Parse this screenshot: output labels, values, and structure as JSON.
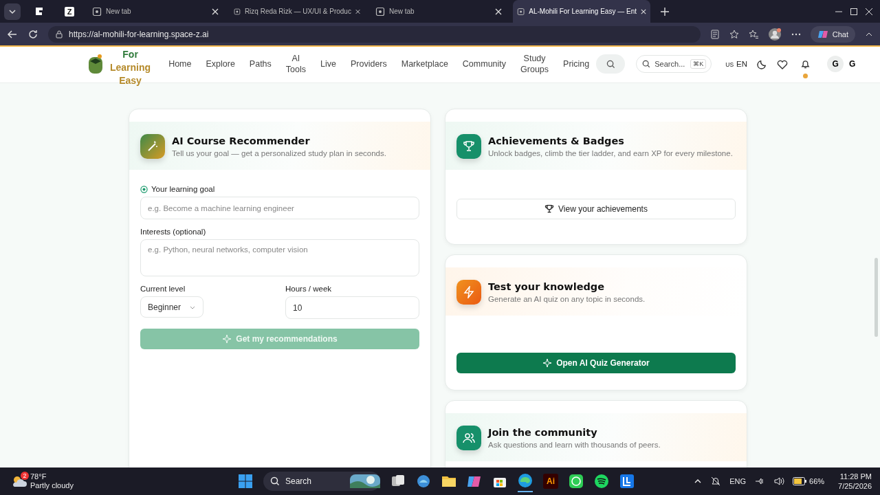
{
  "browser": {
    "pinned": [
      {
        "kind": "logo"
      },
      {
        "kind": "letter",
        "label": "Z"
      }
    ],
    "tabs": [
      {
        "label": "New tab",
        "selected": false
      },
      {
        "label": "Rizq Reda Rizk — UX/UI & Produc",
        "selected": false
      },
      {
        "label": "New tab",
        "selected": false
      },
      {
        "label": "AL-Mohili For Learning Easy — Ent",
        "selected": true
      }
    ],
    "url": "https://al-mohili-for-learning.space-z.ai",
    "chat": "Chat"
  },
  "header": {
    "logo_lines": [
      "For",
      "Learning",
      "Easy"
    ],
    "nav": [
      "Home",
      "Explore",
      "Paths",
      "AI Tools",
      "Live",
      "Providers",
      "Marketplace",
      "Community",
      "Study Groups",
      "Pricing"
    ],
    "search": {
      "placeholder": "Search...",
      "shortcut": "⌘K"
    },
    "locale": {
      "flag": "US",
      "lang": "EN"
    },
    "notification": true,
    "avatar": "G",
    "user": "G"
  },
  "recommender": {
    "title": "AI Course Recommender",
    "subtitle": "Tell us your goal — get a personalized study plan in seconds.",
    "goal_label": "Your learning goal",
    "goal_placeholder": "e.g. Become a machine learning engineer",
    "interests_label": "Interests (optional)",
    "interests_placeholder": "e.g. Python, neural networks, computer vision",
    "level_label": "Current level",
    "level_value": "Beginner",
    "hours_label": "Hours / week",
    "hours_value": "10",
    "button": {
      "label": "Get my recommendations",
      "disabled": true
    }
  },
  "cards": [
    {
      "kind": "trophy",
      "title": "Achievements & Badges",
      "subtitle": "Unlock badges, climb the tier ladder, and earn XP for every milestone.",
      "button": {
        "label": "View your achievements",
        "primary": false
      }
    },
    {
      "kind": "bolt",
      "title": "Test your knowledge",
      "subtitle": "Generate an AI quiz on any topic in seconds.",
      "button": {
        "label": "Open AI Quiz Generator",
        "primary": true
      }
    },
    {
      "kind": "people",
      "title": "Join the community",
      "subtitle": "Ask questions and learn with thousands of peers."
    }
  ],
  "taskbar": {
    "weather_badge": "2",
    "temperature": "78°F",
    "condition": "Partly cloudy",
    "search": "Search",
    "illustrator": "Ai",
    "language": "ENG",
    "battery": "66%",
    "time": "11:28 PM",
    "date": "7/25/2026"
  }
}
